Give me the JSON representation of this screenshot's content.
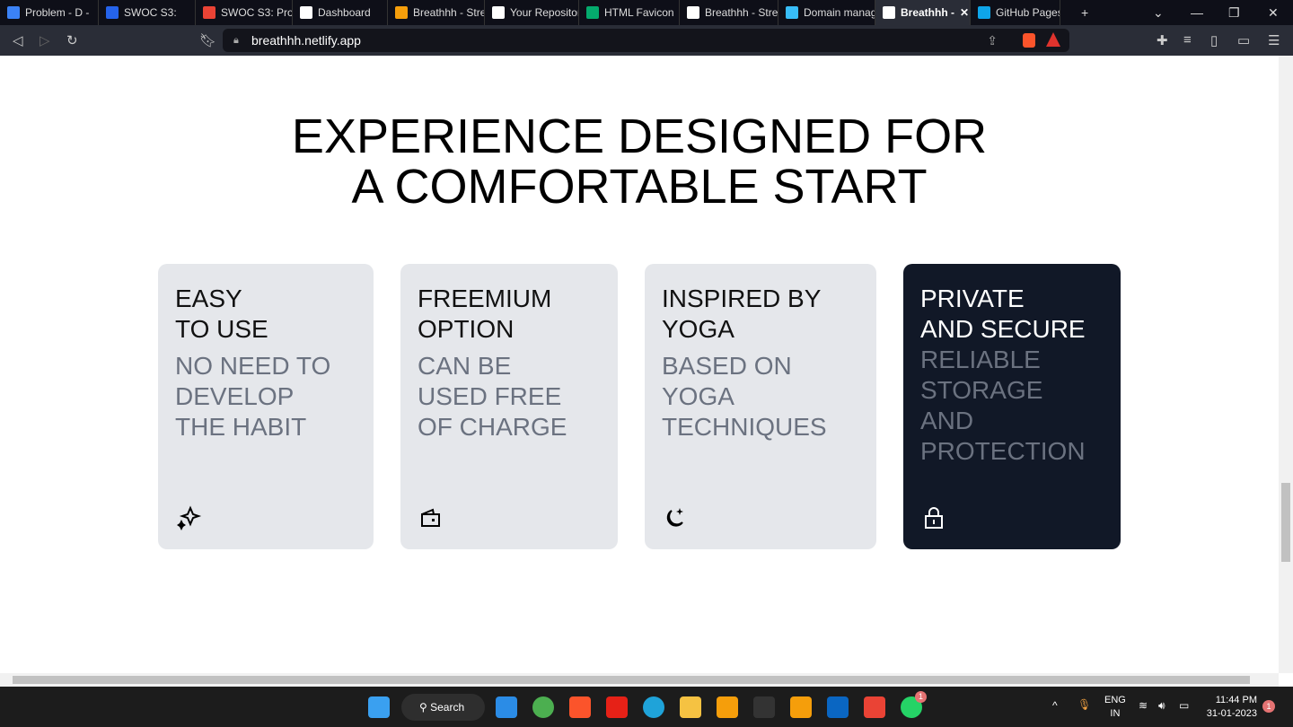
{
  "browser": {
    "tabs": [
      {
        "label": "Problem - D -",
        "color": "#3b82f6"
      },
      {
        "label": "SWOC S3:",
        "color": "#2563eb"
      },
      {
        "label": "SWOC S3: Proj",
        "color": "#ea4335"
      },
      {
        "label": "Dashboard",
        "color": "#ffffff"
      },
      {
        "label": "Breathhh - Stre",
        "color": "#f59e0b"
      },
      {
        "label": "Your Repositor",
        "color": "#ffffff"
      },
      {
        "label": "HTML Favicon",
        "color": "#04aa6d"
      },
      {
        "label": "Breathhh - Stre",
        "color": "#ffffff"
      },
      {
        "label": "Domain manag",
        "color": "#38bdf8"
      },
      {
        "label": "Breathhh -",
        "color": "#ffffff",
        "active": true
      },
      {
        "label": "GitHub Pages",
        "color": "#0ea5e9"
      }
    ],
    "url": "breathhh.netlify.app"
  },
  "page": {
    "heading_line1": "EXPERIENCE DESIGNED FOR",
    "heading_line2": "A COMFORTABLE START",
    "cards": [
      {
        "title": "EASY\nTO USE",
        "subtitle": "NO NEED TO\nDEVELOP\nTHE HABIT",
        "icon": "sparkles-icon"
      },
      {
        "title": "FREEMIUM\nOPTION",
        "subtitle": "CAN BE\nUSED FREE\nOF CHARGE",
        "icon": "wallet-icon"
      },
      {
        "title": "INSPIRED BY\nYOGA",
        "subtitle": "BASED ON\nYOGA\nTECHNIQUES",
        "icon": "moon-star-icon"
      },
      {
        "title": "PRIVATE\nAND SECURE",
        "subtitle": "RELIABLE\nSTORAGE\nAND\nPROTECTION",
        "icon": "lock-icon"
      }
    ]
  },
  "taskbar": {
    "search_label": "Search",
    "lang_line1": "ENG",
    "lang_line2": "IN",
    "time": "11:44 PM",
    "date": "31-01-2023",
    "notification_count": "1",
    "whatsapp_badge": "1"
  }
}
